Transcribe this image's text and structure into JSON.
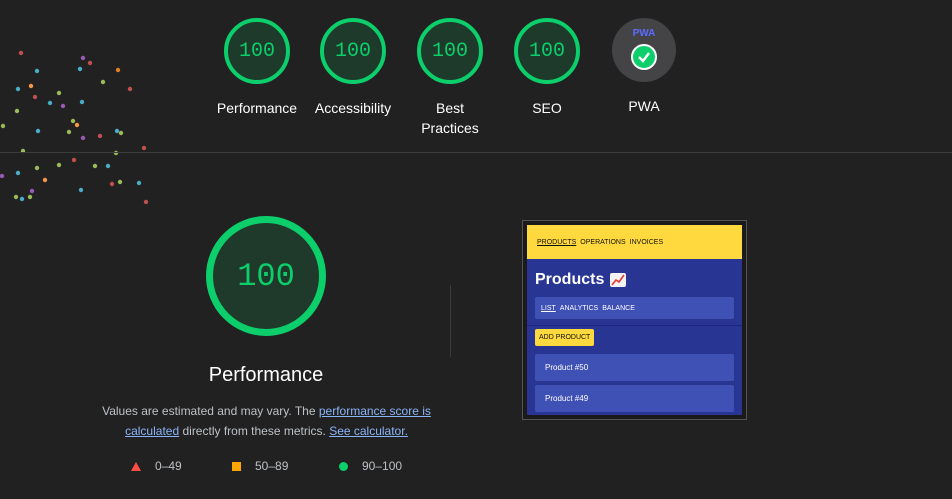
{
  "gauges": [
    {
      "score": "100",
      "label": "Performance"
    },
    {
      "score": "100",
      "label": "Accessibility"
    },
    {
      "score": "100",
      "label": "Best Practices"
    },
    {
      "score": "100",
      "label": "SEO"
    }
  ],
  "pwa": {
    "badge_text": "PWA",
    "label": "PWA"
  },
  "main": {
    "score": "100",
    "title": "Performance",
    "desc_pre": "Values are estimated and may vary. The ",
    "desc_link1": "performance score is calculated",
    "desc_mid": " directly from these metrics. ",
    "desc_link2": "See calculator."
  },
  "legend": {
    "fail": "0–49",
    "average": "50–89",
    "pass": "90–100"
  },
  "colors": {
    "pass": "#0cce6b",
    "average": "#ffa400",
    "fail": "#ff4e42",
    "link": "#8ab4f8"
  },
  "screenshot": {
    "nav": [
      "PRODUCTS",
      "OPERATIONS",
      "INVOICES"
    ],
    "title": "Products",
    "subnav": [
      "LIST",
      "ANALYTICS",
      "BALANCE"
    ],
    "add_button": "ADD PRODUCT",
    "products": [
      "Product #50",
      "Product #49"
    ]
  }
}
